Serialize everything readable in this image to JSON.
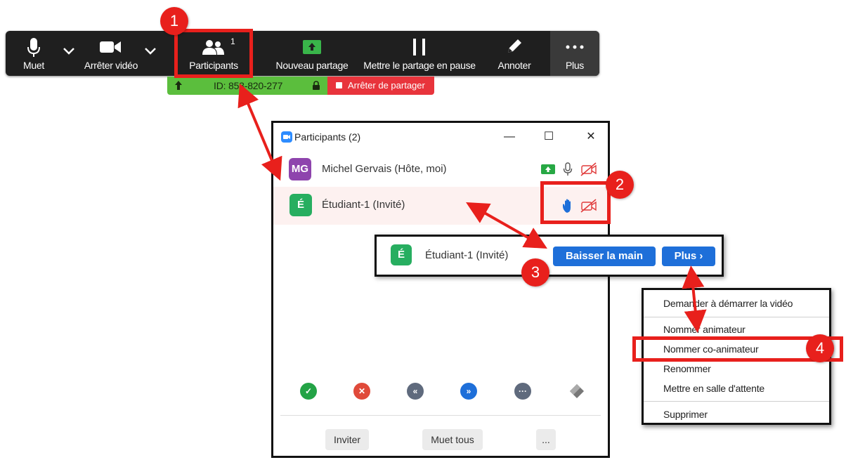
{
  "toolbar": {
    "mute": "Muet",
    "stop_video": "Arrêter vidéo",
    "participants": "Participants",
    "participant_count": "1",
    "new_share": "Nouveau partage",
    "pause_share": "Mettre le partage en pause",
    "annotate": "Annoter",
    "more": "Plus"
  },
  "status_bar": {
    "meeting_id": "ID: 853-820-277",
    "stop_share": "Arrêter de partager"
  },
  "participants_window": {
    "title": "Participants (2)",
    "participants": [
      {
        "initials": "MG",
        "name": "Michel Gervais (Hôte, moi)",
        "color": "#8e44ad"
      },
      {
        "initials": "É",
        "name": "Étudiant-1 (Invité)",
        "color": "#27ae60"
      }
    ],
    "buttons": {
      "invite": "Inviter",
      "mute_all": "Muet tous",
      "more": "..."
    }
  },
  "hover_row": {
    "initials": "É",
    "name": "Étudiant-1 (Invité)",
    "lower_hand": "Baisser la main",
    "more": "Plus ›"
  },
  "context_menu": {
    "items": [
      "Demander à démarrer la vidéo",
      "Nommer animateur",
      "Nommer co-animateur",
      "Renommer",
      "Mettre en salle d'attente",
      "Supprimer"
    ]
  },
  "annotations": {
    "steps": [
      "1",
      "2",
      "3",
      "4"
    ]
  },
  "colors": {
    "accent_red": "#e8201c",
    "zoom_blue": "#1e6fd9",
    "share_green": "#5bbe3d"
  }
}
